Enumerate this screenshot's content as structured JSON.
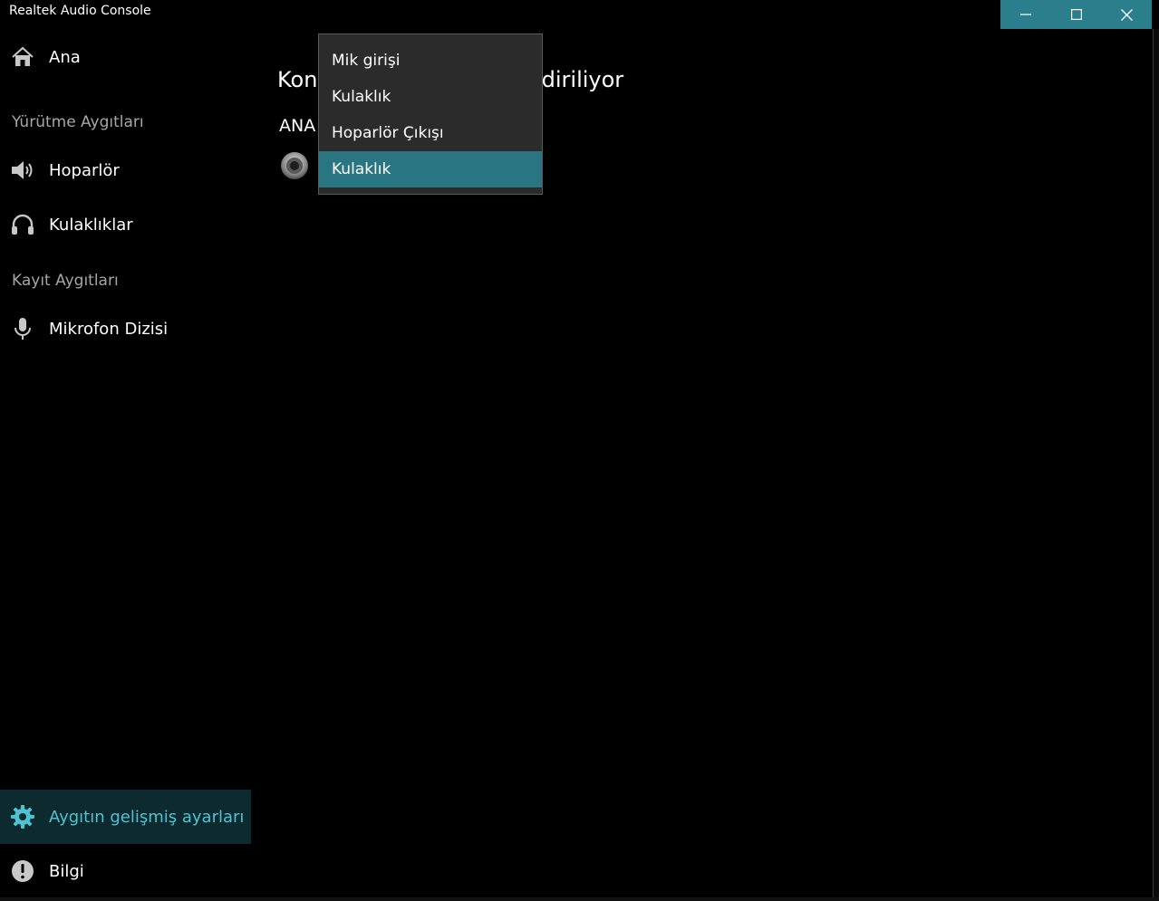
{
  "window": {
    "title": "Realtek Audio Console",
    "accent_color": "#2b7f8c"
  },
  "caption": {
    "minimize_icon": "minimize-icon",
    "maximize_icon": "maximize-icon",
    "close_icon": "close-icon"
  },
  "sidebar": {
    "home": {
      "label": "Ana",
      "icon": "home-icon"
    },
    "playback_header": "Yürütme Aygıtları",
    "playback_items": [
      {
        "label": "Hoparlör",
        "icon": "speaker-icon"
      },
      {
        "label": "Kulaklıklar",
        "icon": "headphones-icon"
      }
    ],
    "recording_header": "Kayıt Aygıtları",
    "recording_items": [
      {
        "label": "Mikrofon Dizisi",
        "icon": "microphone-icon"
      }
    ],
    "advanced": {
      "label": "Aygıtın gelişmiş ayarları",
      "icon": "gear-icon"
    },
    "info": {
      "label": "Bilgi",
      "icon": "info-icon"
    }
  },
  "main": {
    "title_start": "Kon",
    "title_end": "ndiriliyor",
    "subtitle": "ANA"
  },
  "dropdown": {
    "options": [
      "Mik girişi",
      "Kulaklık",
      "Hoparlör Çıkışı",
      "Kulaklık"
    ],
    "selected_index": 3,
    "selected_color": "#2a7582"
  }
}
